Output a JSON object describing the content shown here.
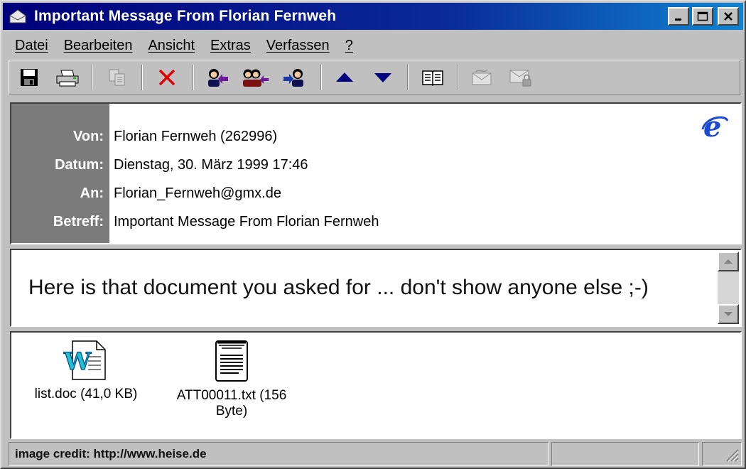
{
  "window": {
    "title": "Important Message From Florian Fernweh"
  },
  "menu": [
    "Datei",
    "Bearbeiten",
    "Ansicht",
    "Extras",
    "Verfassen",
    "?"
  ],
  "header": {
    "from_label": "Von:",
    "from_value": "Florian Fernweh (262996)",
    "date_label": "Datum:",
    "date_value": "Dienstag, 30. März 1999 17:46",
    "to_label": "An:",
    "to_value": "Florian_Fernweh@gmx.de",
    "subject_label": "Betreff:",
    "subject_value": "Important Message From Florian Fernweh"
  },
  "body": {
    "text": "Here is that document you asked for ... don't show anyone else ;-)"
  },
  "attachments": [
    {
      "name": "list.doc (41,0 KB)",
      "icon": "word-document-icon"
    },
    {
      "line1": "ATT00011.txt (156",
      "line2": "Byte)",
      "icon": "text-file-icon"
    }
  ],
  "status": {
    "text": "image credit: http://www.heise.de"
  },
  "colors": {
    "titlebar": "#00007b",
    "label_bg": "#7b7b7b",
    "delete_red": "#e00000",
    "arrow_blue": "#000080"
  }
}
